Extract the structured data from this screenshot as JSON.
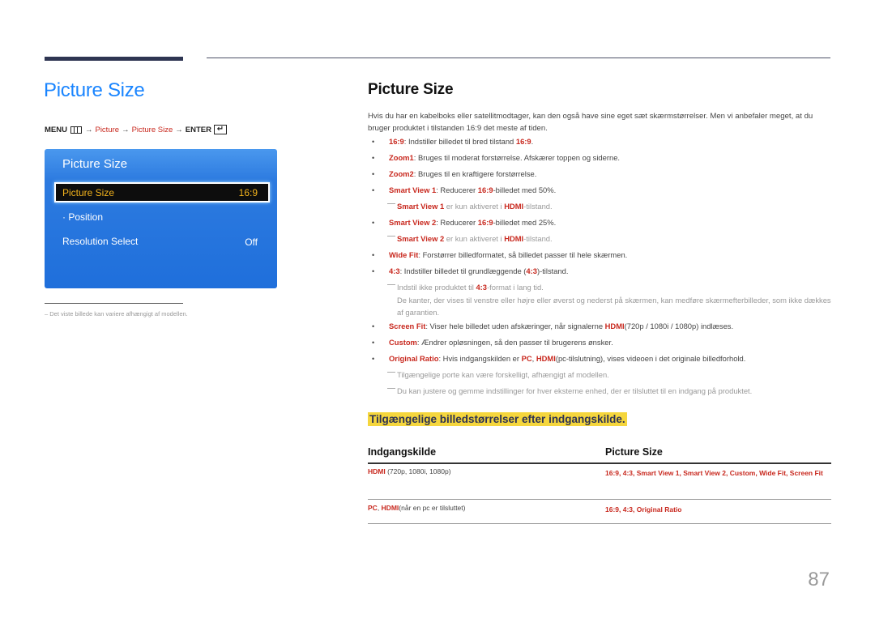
{
  "left": {
    "title": "Picture Size",
    "menu_path": {
      "menu": "MENU",
      "arrow": "→",
      "picture": "Picture",
      "picture_size": "Picture Size",
      "enter": "ENTER",
      "menu_icon": "menu-grid-icon",
      "enter_icon": "enter-return-icon",
      "enter_glyph": "↵"
    },
    "osd": {
      "title": "Picture Size",
      "selected_label": "Picture Size",
      "selected_value": "16:9",
      "position_label": "· Position",
      "resolution_label": "Resolution Select",
      "resolution_value": "Off"
    },
    "footnote": "– Det viste billede kan variere afhængigt af modellen."
  },
  "right": {
    "title": "Picture Size",
    "intro": "Hvis du har en kabelboks eller satellitmodtager, kan den også have sine eget sæt skærmstørrelser. Men vi anbefaler meget, at du bruger produktet i tilstanden 16:9 det meste af tiden.",
    "items": {
      "b1": {
        "key": "16:9",
        "text": ": Indstiller billedet til bred tilstand ",
        "key2": "16:9",
        "end": "."
      },
      "b2": {
        "key": "Zoom1",
        "text": ": Bruges til moderat forstørrelse. Afskærer toppen og siderne."
      },
      "b3": {
        "key": "Zoom2",
        "text": ": Bruges til en kraftigere forstørrelse."
      },
      "b4": {
        "key": "Smart View 1",
        "text": ": Reducerer ",
        "key2": "16:9",
        "end": "-billedet med 50%."
      },
      "n4": {
        "key": "Smart View 1",
        "text": " er kun aktiveret i ",
        "key2": "HDMI",
        "end": "-tilstand."
      },
      "b5": {
        "key": "Smart View 2",
        "text": ": Reducerer ",
        "key2": "16:9",
        "end": "-billedet med 25%."
      },
      "n5": {
        "key": "Smart View 2",
        "text": " er kun aktiveret i ",
        "key2": "HDMI",
        "end": "-tilstand."
      },
      "b6": {
        "key": "Wide Fit",
        "text": ": Forstørrer billedformatet, så billedet passer til hele skærmen."
      },
      "b7": {
        "key": "4:3",
        "text": ": Indstiller billedet til grundlæggende (",
        "key2": "4:3",
        "end": ")-tilstand."
      },
      "n7": {
        "text": "Indstil ikke produktet til ",
        "key": "4:3",
        "end": "-format i lang tid."
      },
      "n7b": "De kanter, der vises til venstre eller højre eller øverst og nederst på skærmen, kan medføre skærmefterbilleder, som ikke dækkes af garantien.",
      "b8": {
        "key": "Screen Fit",
        "text": ": Viser hele billedet uden afskæringer, når signalerne ",
        "key2": "HDMI",
        "end": "(720p / 1080i / 1080p) indlæses."
      },
      "b9": {
        "key": "Custom",
        "text": ": Ændrer opløsningen, så den passer til brugerens ønsker."
      },
      "b10": {
        "key": "Original Ratio",
        "text": ": Hvis indgangskilden er ",
        "key2": "PC",
        "sep": ", ",
        "key3": "HDMI",
        "end": "(pc-tilslutning), vises videoen i det originale billedforhold."
      },
      "n10a": "Tilgængelige porte kan være forskelligt, afhængigt af modellen.",
      "n10b": "Du kan justere og gemme indstillinger for hver eksterne enhed, der er tilsluttet til en indgang på produktet."
    },
    "highlight_heading": "Tilgængelige billedstørrelser efter indgangskilde.",
    "table": {
      "headers": [
        "Indgangskilde",
        "Picture Size"
      ],
      "rows": [
        {
          "source_key": "HDMI",
          "source_text": " (720p, 1080i, 1080p)",
          "sizes": "16:9, 4:3, Smart View 1, Smart View 2, Custom, Wide Fit, Screen Fit"
        },
        {
          "source_key": "PC",
          "source_sep": ", ",
          "source_key2": "HDMI",
          "source_text": "(når en pc er tilsluttet)",
          "sizes": "16:9, 4:3, Original Ratio"
        }
      ]
    }
  },
  "page_number": "87",
  "colors": {
    "accent_blue": "#1a85ff",
    "accent_red": "#c8281e",
    "highlight_yellow": "#f5d63d",
    "osd_blue": "#1f6fdb",
    "osd_selected_text": "#f2b21c"
  }
}
